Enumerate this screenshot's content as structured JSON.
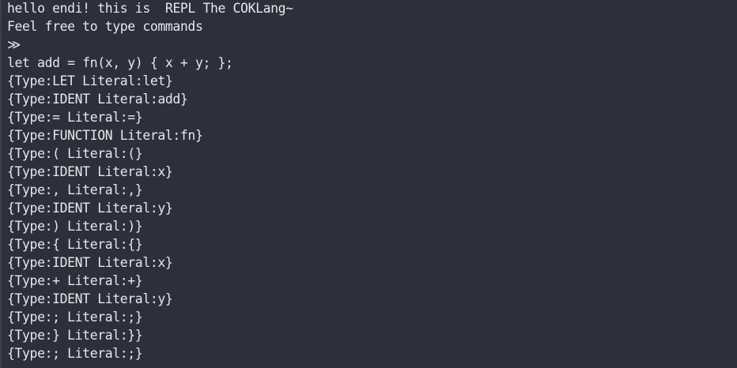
{
  "terminal": {
    "lines": [
      "hello endi! this is  REPL The COKLang~",
      "Feel free to type commands",
      "≫",
      "let add = fn(x, y) { x + y; };",
      "{Type:LET Literal:let}",
      "{Type:IDENT Literal:add}",
      "{Type:= Literal:=}",
      "{Type:FUNCTION Literal:fn}",
      "{Type:( Literal:(}",
      "{Type:IDENT Literal:x}",
      "{Type:, Literal:,}",
      "{Type:IDENT Literal:y}",
      "{Type:) Literal:)}",
      "{Type:{ Literal:{}",
      "{Type:IDENT Literal:x}",
      "{Type:+ Literal:+}",
      "{Type:IDENT Literal:y}",
      "{Type:; Literal:;}",
      "{Type:} Literal:}}",
      "{Type:; Literal:;}",
      "≫"
    ]
  }
}
